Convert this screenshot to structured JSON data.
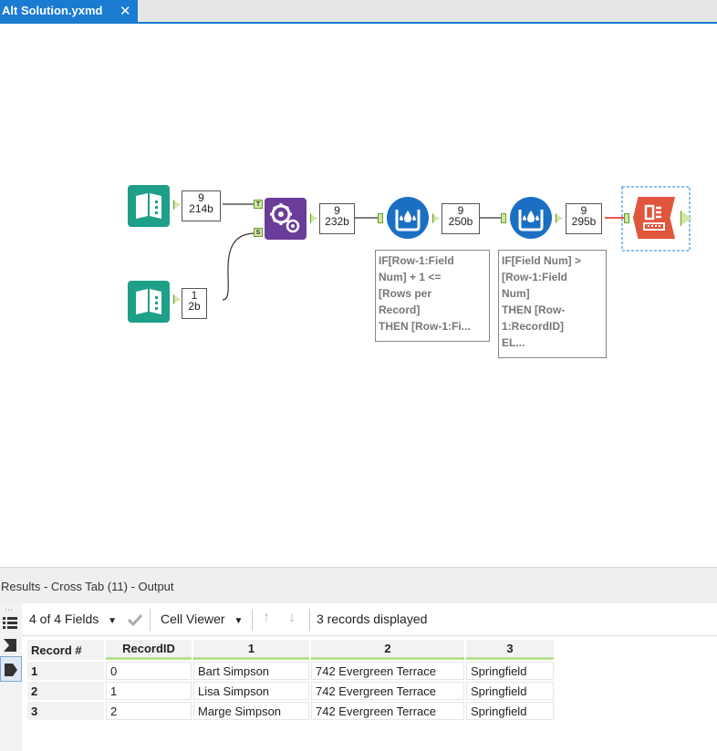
{
  "tab": {
    "title": "Alt Solution.yxmd",
    "close": "✕"
  },
  "workflow": {
    "input1_count": {
      "records": "9",
      "size": "214b"
    },
    "input2_count": {
      "records": "1",
      "size": "2b"
    },
    "join_count": {
      "records": "9",
      "size": "232b"
    },
    "formula1_count": {
      "records": "9",
      "size": "250b"
    },
    "formula2_count": {
      "records": "9",
      "size": "295b"
    },
    "join_in_t": "T",
    "join_in_s": "S",
    "formula1_annotation": "IF[Row-1:Field\nNum] + 1 <=\n[Rows per\nRecord]\nTHEN [Row-1:Fi...",
    "formula2_annotation": "IF[Field Num] >\n[Row-1:Field\nNum]\nTHEN [Row-\n1:RecordID]\nEL..."
  },
  "results": {
    "header": "Results - Cross Tab (11) - Output",
    "fields_label": "4 of 4 Fields",
    "cell_viewer_label": "Cell Viewer",
    "records_displayed": "3 records displayed",
    "columns": [
      "Record #",
      "RecordID",
      "1",
      "2",
      "3"
    ],
    "rows": [
      [
        "1",
        "0",
        "Bart Simpson",
        "742 Evergreen Terrace",
        "Springfield"
      ],
      [
        "2",
        "1",
        "Lisa Simpson",
        "742 Evergreen Terrace",
        "Springfield"
      ],
      [
        "3",
        "2",
        "Marge Simpson",
        "742 Evergreen Terrace",
        "Springfield"
      ]
    ]
  },
  "colors": {
    "accent": "#1a7bd1",
    "input_tool": "#1ea088",
    "join_tool": "#6a3d9a",
    "formula_tool": "#1a6fc2",
    "crosstab_tool": "#e0553c"
  },
  "icons": [
    "book-icon",
    "gears-icon",
    "water-drop-icon",
    "crosstab-icon",
    "check-icon",
    "up-arrow-icon",
    "down-arrow-icon",
    "list-icon"
  ]
}
